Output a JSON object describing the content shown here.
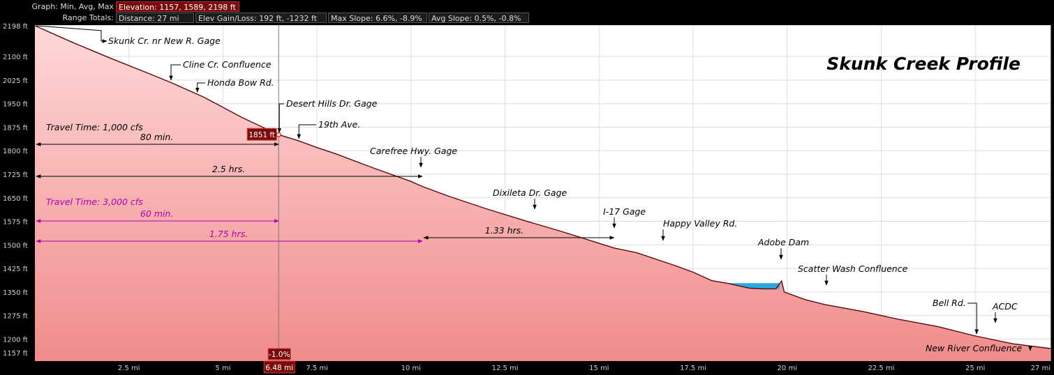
{
  "header": {
    "graph_label": "Graph: Min, Avg, Max",
    "elevation": "Elevation: 1157, 1589, 2198 ft",
    "range_label": "Range Totals:",
    "distance": "Distance: 27 mi",
    "elev_gain": "Elev Gain/Loss: 192 ft, -1232 ft",
    "max_slope": "Max Slope: 6.6%, -8.9%",
    "avg_slope": "Avg Slope: 0.5%, -0.8%"
  },
  "cursor": {
    "x": 6.48,
    "x_label": "6.48 mi",
    "y_label": "1851 ft",
    "slope_label": "-1.0%"
  },
  "colors": {
    "fill_top": "#ffd8d8",
    "fill_bottom": "#f08c8c",
    "profile_line": "#5a0a0a",
    "water": "#2aa8e0",
    "cursor_badge": "#7a0a0a",
    "magenta": "#b000b0"
  },
  "chart_data": {
    "type": "area",
    "title": "Skunk Creek Profile",
    "xlabel": "",
    "ylabel": "",
    "xlim": [
      0,
      27
    ],
    "ylim": [
      1130,
      2200
    ],
    "grid": true,
    "x_ticks": [
      {
        "v": 2.5,
        "label": "2.5 mi"
      },
      {
        "v": 5,
        "label": "5 mi"
      },
      {
        "v": 7.5,
        "label": "7.5 mi"
      },
      {
        "v": 10,
        "label": "10 mi"
      },
      {
        "v": 12.5,
        "label": "12.5 mi"
      },
      {
        "v": 15,
        "label": "15 mi"
      },
      {
        "v": 17.5,
        "label": "17.5 mi"
      },
      {
        "v": 20,
        "label": "20 mi"
      },
      {
        "v": 22.5,
        "label": "22.5 mi"
      },
      {
        "v": 25,
        "label": "25 mi"
      },
      {
        "v": 27,
        "label": "27 mi"
      }
    ],
    "y_ticks": [
      {
        "v": 2198,
        "label": "2198 ft"
      },
      {
        "v": 2100,
        "label": "2100 ft"
      },
      {
        "v": 2025,
        "label": "2025 ft"
      },
      {
        "v": 1950,
        "label": "1950 ft"
      },
      {
        "v": 1875,
        "label": "1875 ft"
      },
      {
        "v": 1800,
        "label": "1800 ft"
      },
      {
        "v": 1725,
        "label": "1725 ft"
      },
      {
        "v": 1650,
        "label": "1650 ft"
      },
      {
        "v": 1575,
        "label": "1575 ft"
      },
      {
        "v": 1500,
        "label": "1500 ft"
      },
      {
        "v": 1425,
        "label": "1425 ft"
      },
      {
        "v": 1350,
        "label": "1350 ft"
      },
      {
        "v": 1275,
        "label": "1275 ft"
      },
      {
        "v": 1200,
        "label": "1200 ft"
      },
      {
        "v": 1157,
        "label": "1157 ft"
      }
    ],
    "series": [
      {
        "x": [
          0,
          1,
          2,
          3,
          3.6,
          4.5,
          5.5,
          6.48,
          7,
          7.5,
          8,
          9,
          10,
          10.3,
          11,
          12,
          13,
          14,
          15,
          15.4,
          16,
          17,
          17.5,
          18,
          18.4,
          19,
          19.4,
          19.7,
          19.85,
          19.92,
          20.5,
          21,
          22,
          23,
          24,
          25,
          26,
          27
        ],
        "y": [
          2198,
          2145,
          2095,
          2047,
          2018,
          1970,
          1906,
          1851,
          1832,
          1810,
          1790,
          1745,
          1702,
          1686,
          1655,
          1615,
          1578,
          1543,
          1505,
          1490,
          1475,
          1435,
          1413,
          1386,
          1378,
          1362,
          1360,
          1360,
          1385,
          1350,
          1325,
          1310,
          1288,
          1262,
          1240,
          1210,
          1185,
          1170
        ]
      }
    ],
    "water": {
      "x": [
        18.4,
        19.8
      ],
      "level": 1378
    },
    "annotations": [
      {
        "text": "Skunk Cr. nr New R. Gage",
        "x": 0,
        "y": 2198
      },
      {
        "text": "Cline Cr. Confluence",
        "x": 3.6,
        "y": 2018
      },
      {
        "text": "Honda Bow Rd.",
        "x": 4.3,
        "y": 1980
      },
      {
        "text": "Desert Hills Dr. Gage",
        "x": 6.48,
        "y": 1851
      },
      {
        "text": "19th Ave.",
        "x": 7.0,
        "y": 1832
      },
      {
        "text": "Carefree Hwy. Gage",
        "x": 10.3,
        "y": 1686
      },
      {
        "text": "Dixileta Dr. Gage",
        "x": 13.3,
        "y": 1570
      },
      {
        "text": "I-17 Gage",
        "x": 15.4,
        "y": 1490
      },
      {
        "text": "Happy Valley Rd.",
        "x": 16.6,
        "y": 1453
      },
      {
        "text": "Adobe Dam",
        "x": 19.85,
        "y": 1385
      },
      {
        "text": "Scatter Wash Confluence",
        "x": 21.0,
        "y": 1310
      },
      {
        "text": "Bell Rd.",
        "x": 25.0,
        "y": 1210
      },
      {
        "text": "ACDC",
        "x": 25.7,
        "y": 1193
      },
      {
        "text": "New River Confluence",
        "x": 27.0,
        "y": 1170
      }
    ],
    "travel_times": [
      {
        "heading": "Travel Time: 1,000 cfs",
        "color": "#000000",
        "spans": [
          {
            "label": "80 min.",
            "x0": 0,
            "x1": 6.48
          },
          {
            "label": "2.5 hrs.",
            "x0": 0,
            "x1": 10.3
          }
        ]
      },
      {
        "heading": "Travel Time: 3,000 cfs",
        "color": "#b000b0",
        "spans": [
          {
            "label": "60 min.",
            "x0": 0,
            "x1": 6.48
          },
          {
            "label": "1.75 hrs.",
            "x0": 0,
            "x1": 10.3
          }
        ]
      }
    ],
    "extra_span": {
      "label": "1.33 hrs.",
      "x0": 10.3,
      "x1": 15.4,
      "color": "#000000"
    }
  }
}
